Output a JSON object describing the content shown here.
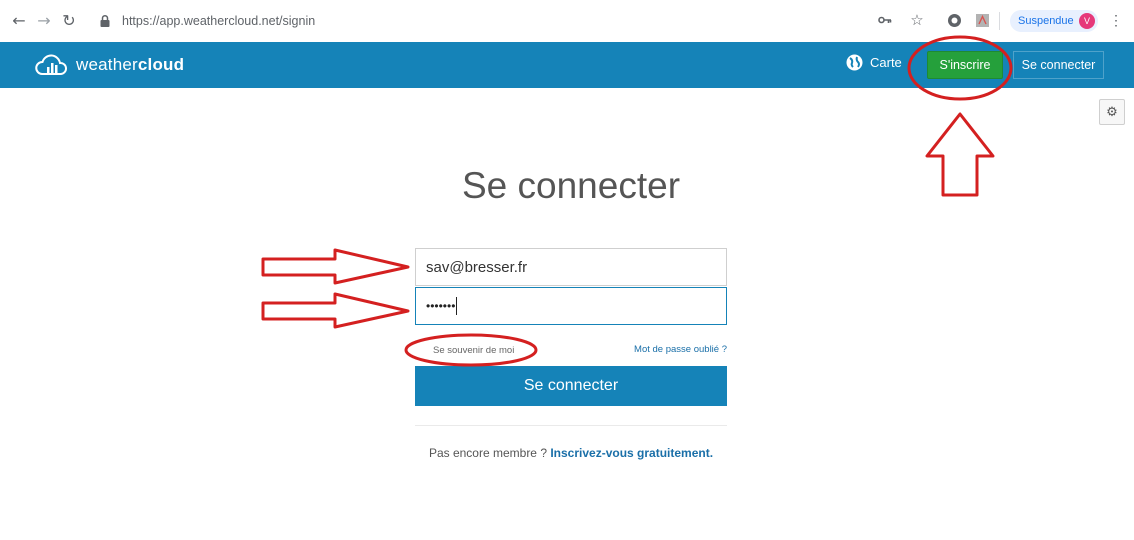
{
  "browser": {
    "url": "https://app.weathercloud.net/signin",
    "profile_label": "Suspendue",
    "avatar_letter": "V",
    "icons": [
      "back-icon",
      "forward-icon",
      "reload-icon",
      "lock-icon",
      "key-icon",
      "star-icon",
      "extension-icon",
      "pdf-icon",
      "menu-icon"
    ]
  },
  "header": {
    "brand_plain": "weather",
    "brand_bold": "cloud",
    "map_label": "Carte",
    "signup_label": "S'inscrire",
    "signin_label": "Se connecter",
    "colors": {
      "bar": "#1583b8",
      "signup": "#25a03b"
    }
  },
  "main": {
    "title": "Se connecter",
    "email_value": "sav@bresser.fr",
    "password_mask": "•••••••",
    "remember_label": "Se souvenir de moi",
    "forgot_label": "Mot de passe oublié ?",
    "submit_label": "Se connecter",
    "signup_prompt": "Pas encore membre ? ",
    "signup_link": "Inscrivez-vous gratuitement."
  },
  "annotations": {
    "color": "#d42020"
  }
}
